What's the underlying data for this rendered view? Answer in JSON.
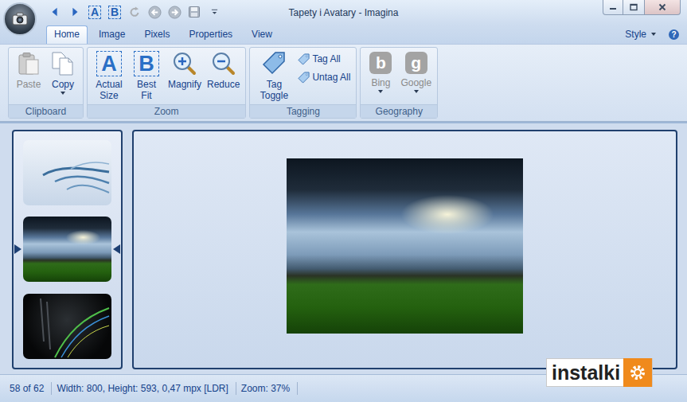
{
  "window": {
    "title": "Tapety i Avatary - Imagina"
  },
  "quick_access": [
    {
      "kind": "back",
      "disabled": false
    },
    {
      "kind": "forward",
      "disabled": false
    },
    {
      "kind": "glyph",
      "glyph": "A",
      "disabled": false
    },
    {
      "kind": "glyph",
      "glyph": "B",
      "disabled": false
    },
    {
      "kind": "rotate",
      "disabled": true
    },
    {
      "kind": "previous",
      "disabled": false
    },
    {
      "kind": "next",
      "disabled": false
    },
    {
      "kind": "save",
      "disabled": false
    },
    {
      "kind": "customize",
      "disabled": false
    }
  ],
  "tabs": [
    {
      "label": "Home",
      "selected": true
    },
    {
      "label": "Image",
      "selected": false
    },
    {
      "label": "Pixels",
      "selected": false
    },
    {
      "label": "Properties",
      "selected": false
    },
    {
      "label": "View",
      "selected": false
    }
  ],
  "style_menu": {
    "label": "Style"
  },
  "help": "?",
  "ribbon_groups": [
    {
      "label": "Clipboard",
      "buttons": [
        {
          "label": "Paste",
          "kind": "large",
          "disabled": true,
          "dropdown": false
        },
        {
          "label": "Copy",
          "kind": "large",
          "disabled": false,
          "dropdown": true
        }
      ]
    },
    {
      "label": "Zoom",
      "buttons": [
        {
          "label": "Actual Size",
          "kind": "glyph",
          "glyph": "A",
          "disabled": false,
          "dropdown": false
        },
        {
          "label": "Best Fit",
          "kind": "glyph",
          "glyph": "B",
          "disabled": false,
          "dropdown": false
        },
        {
          "label": "Magnify",
          "kind": "large",
          "disabled": false,
          "dropdown": false
        },
        {
          "label": "Reduce",
          "kind": "large",
          "disabled": false,
          "dropdown": false
        }
      ]
    },
    {
      "label": "Tagging",
      "buttons": [
        {
          "label": "Tag Toggle",
          "kind": "large",
          "disabled": false,
          "dropdown": false
        },
        {
          "label": "Tag All",
          "kind": "small",
          "disabled": false,
          "dropdown": false
        },
        {
          "label": "Untag All",
          "kind": "small",
          "disabled": false,
          "dropdown": false
        }
      ]
    },
    {
      "label": "Geography",
      "buttons": [
        {
          "label": "Bing",
          "kind": "logo",
          "glyph": "b",
          "disabled": true,
          "dropdown": true
        },
        {
          "label": "Google",
          "kind": "logo",
          "glyph": "g",
          "disabled": true,
          "dropdown": true
        }
      ]
    }
  ],
  "thumbnails": [
    {
      "kind": "wisps",
      "selected": false
    },
    {
      "kind": "landscape",
      "selected": true
    },
    {
      "kind": "dark-lines",
      "selected": false
    }
  ],
  "status_bar": [
    "58 of 62",
    "Width: 800, Height: 593, 0,47 mpx [LDR]",
    "Zoom: 37%"
  ],
  "watermark": "instalki"
}
